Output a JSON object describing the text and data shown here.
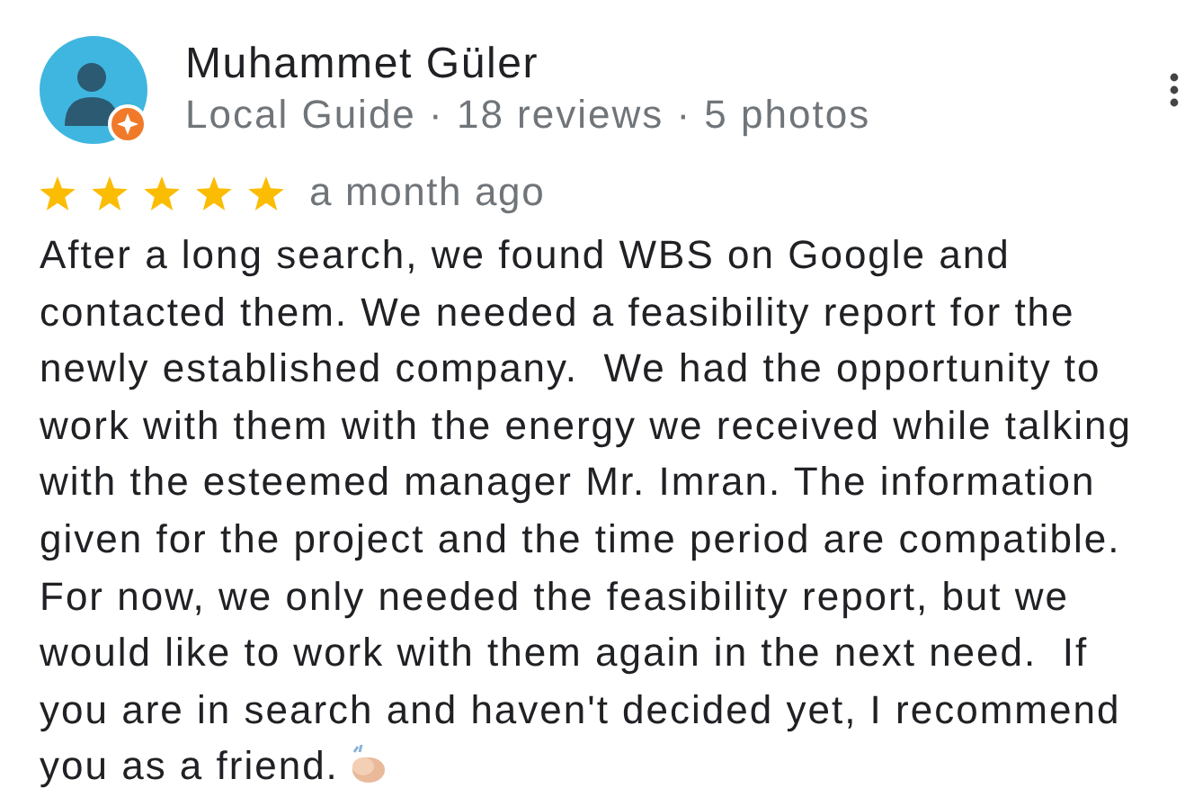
{
  "review": {
    "author": "Muhammet Güler",
    "meta": "Local Guide · 18 reviews · 5 photos",
    "stars": 5,
    "time": "a month ago",
    "body_lines": [
      "After a long search, we found WBS on Google and",
      "contacted them. We needed a feasibility report for the",
      "newly established company.  We had the opportunity to",
      "work with them with the energy we received while talking",
      "with the esteemed manager Mr. Imran. The information",
      "given for the project and the time period are compatible.",
      "For now, we only needed the feasibility report, but we",
      "would like to work with them again in the next need.  If",
      "you are in search and haven't decided yet, I recommend",
      "you as a friend."
    ]
  }
}
